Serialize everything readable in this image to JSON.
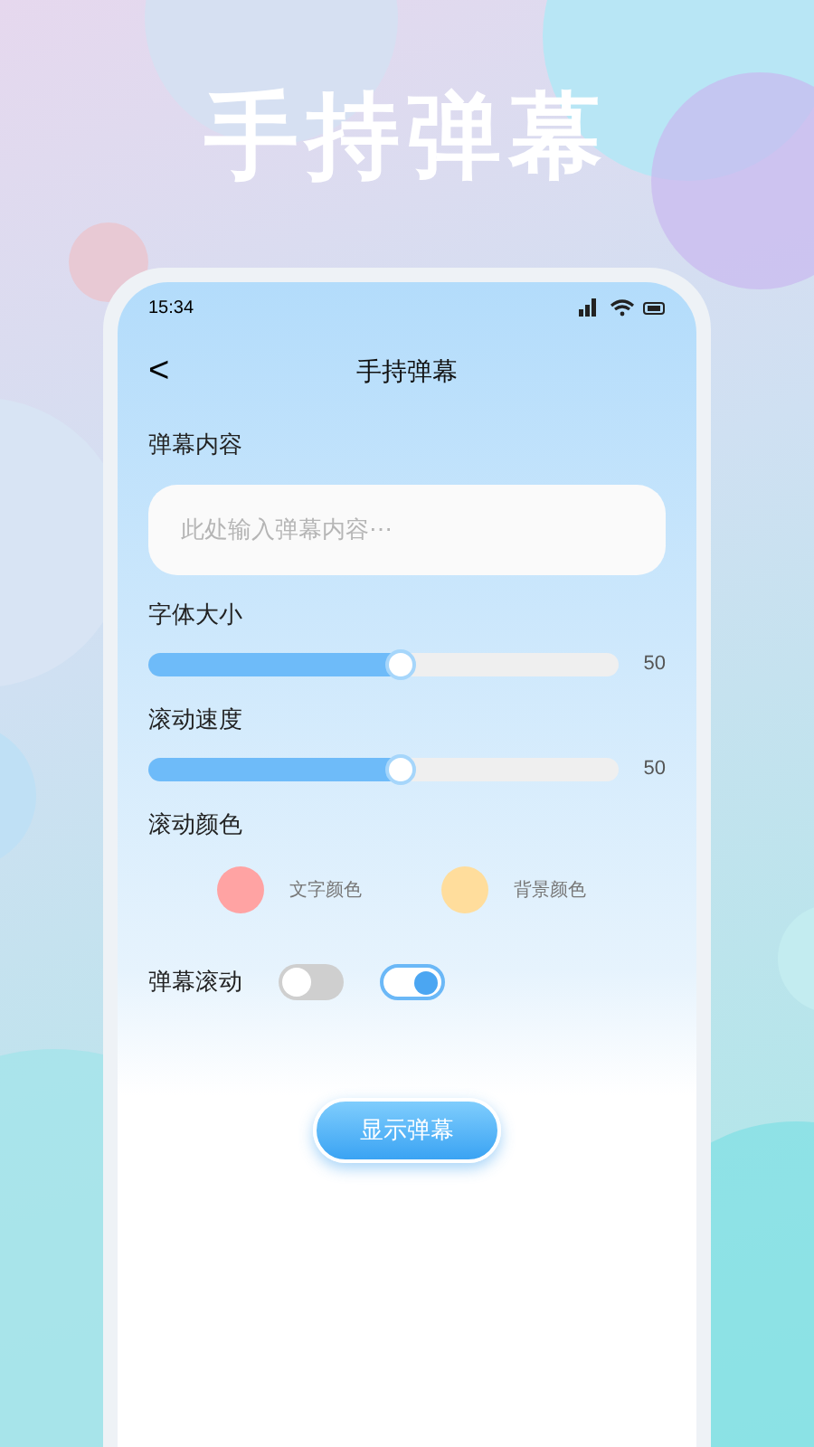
{
  "headline": "手持弹幕",
  "status_bar": {
    "time": "15:34"
  },
  "nav": {
    "back": "<",
    "title": "手持弹幕"
  },
  "content": {
    "label": "弹幕内容",
    "placeholder": "此处输入弹幕内容⋯"
  },
  "sliders": [
    {
      "label": "字体大小",
      "level": 0.54,
      "reading": "50"
    },
    {
      "label": "滚动速度",
      "level": 0.54,
      "reading": "50"
    }
  ],
  "colors": {
    "label": "滚动颜色",
    "items": [
      {
        "label": "文字颜色",
        "color": "#ffa3a3"
      },
      {
        "label": "背景颜色",
        "color": "#ffdd9c"
      }
    ]
  },
  "scroll": {
    "label": "弹幕滚动",
    "toggles": [
      {
        "on": false
      },
      {
        "on": true
      }
    ]
  },
  "button": "显示弹幕"
}
